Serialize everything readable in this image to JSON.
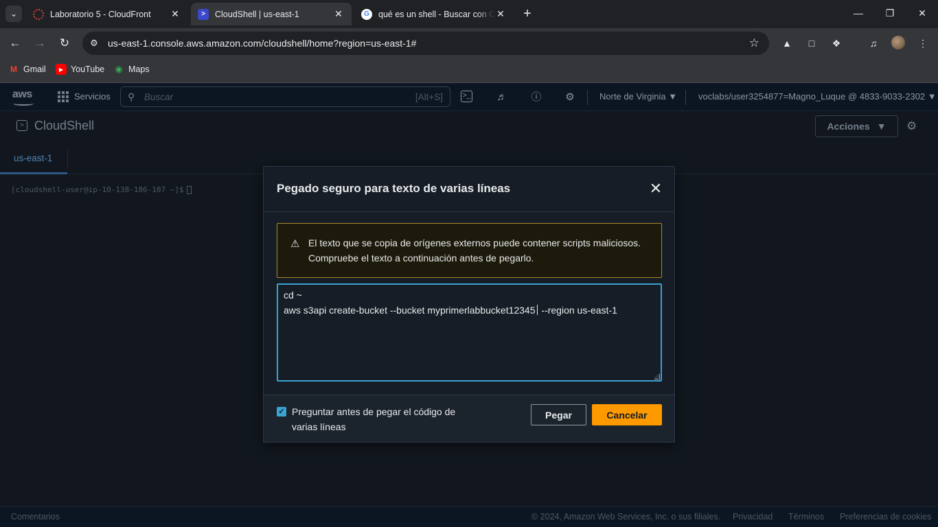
{
  "browser": {
    "tabs": [
      {
        "title": "Laboratorio 5 - CloudFront",
        "favicon": "aws-academy-icon"
      },
      {
        "title": "CloudShell | us-east-1",
        "favicon": "cloudshell-icon",
        "active": true
      },
      {
        "title": "qué es un shell - Buscar con Google",
        "favicon": "google-icon"
      }
    ],
    "url": "us-east-1.console.aws.amazon.com/cloudshell/home?region=us-east-1#",
    "bookmarks": [
      {
        "label": "Gmail",
        "icon": "gmail-icon"
      },
      {
        "label": "YouTube",
        "icon": "youtube-icon"
      },
      {
        "label": "Maps",
        "icon": "maps-icon"
      }
    ]
  },
  "aws": {
    "logo": "aws",
    "services_label": "Servicios",
    "search_placeholder": "Buscar",
    "search_shortcut": "[Alt+S]",
    "region": "Norte de Virginia",
    "user": "voclabs/user3254877=Magno_Luque @ 4833-9033-2302",
    "page_title": "CloudShell",
    "actions_label": "Acciones",
    "tab_label": "us-east-1",
    "terminal_prompt": "[cloudshell-user@ip-10-138-186-107 ~]$"
  },
  "modal": {
    "title": "Pegado seguro para texto de varias líneas",
    "warning_line1": "El texto que se copia de orígenes externos puede contener scripts maliciosos.",
    "warning_line2": "Compruebe el texto a continuación antes de pegarlo.",
    "text_line1": "cd ~",
    "text_line2_before_cursor": "aws s3api create-bucket --bucket myprimerlabbucket12345",
    "text_line2_after_cursor": " --region us-east-1",
    "checkbox_line1": "Preguntar antes de pegar el código de",
    "checkbox_line2": "varias líneas",
    "checkbox_checked": true,
    "paste_label": "Pegar",
    "cancel_label": "Cancelar"
  },
  "footer": {
    "feedback": "Comentarios",
    "copyright": "© 2024, Amazon Web Services, Inc. o sus filiales.",
    "privacy": "Privacidad",
    "terms": "Términos",
    "cookies": "Preferencias de cookies"
  },
  "colors": {
    "accent_orange": "#ff9900",
    "focus_blue": "#3aa3d1",
    "warning_border": "#a88a2a"
  }
}
